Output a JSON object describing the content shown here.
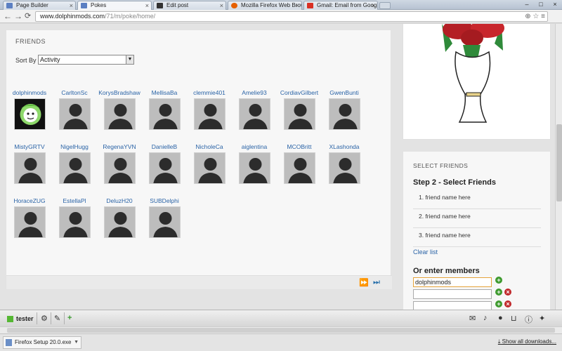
{
  "browser": {
    "tabs": [
      {
        "label": "Page Builder",
        "active": false,
        "color": "#5b7fc2"
      },
      {
        "label": "Pokes",
        "active": true,
        "color": "#5b7fc2"
      },
      {
        "label": "Edit post",
        "active": false,
        "color": "#333333"
      },
      {
        "label": "Mozilla Firefox Web Brow...",
        "active": false,
        "color": "#e66000"
      },
      {
        "label": "Gmail: Email from Google",
        "active": false,
        "color": "#d93025"
      }
    ],
    "url_host": "www.dolphinmods.com",
    "url_path": "/71/m/poke/home/"
  },
  "friends": {
    "title": "FRIENDS",
    "sort_label": "Sort By",
    "sort_value": "Activity",
    "items": [
      {
        "name": "dolphinmods",
        "me": true
      },
      {
        "name": "CarltonSc"
      },
      {
        "name": "KorysBradshaw"
      },
      {
        "name": "MellisaBa"
      },
      {
        "name": "clemmie401"
      },
      {
        "name": "Amelie93"
      },
      {
        "name": "CordiavGilbert"
      },
      {
        "name": "GwenBunti"
      },
      {
        "name": "MistyGRTV"
      },
      {
        "name": "NigelHugg"
      },
      {
        "name": "RegenaYVN"
      },
      {
        "name": "DanielleB"
      },
      {
        "name": "NicholeCa"
      },
      {
        "name": "aiglentina"
      },
      {
        "name": "MCOBritt"
      },
      {
        "name": "XLashonda"
      },
      {
        "name": "HoraceZUG"
      },
      {
        "name": "EstellaPl"
      },
      {
        "name": "DeluzH20"
      },
      {
        "name": "SUBDelphi"
      }
    ]
  },
  "select_friends": {
    "title": "SELECT FRIENDS",
    "step_title": "Step 2 - Select Friends",
    "slots": [
      "1. friend name here",
      "2. friend name here",
      "3. friend name here"
    ],
    "clear_label": "Clear list",
    "members_title": "Or enter members",
    "members": [
      "dolphinmods",
      "",
      ""
    ]
  },
  "toolbar": {
    "username": "tester"
  },
  "downloads": {
    "file": "Firefox Setup 20.0.exe",
    "show_all": "Show all downloads..."
  }
}
